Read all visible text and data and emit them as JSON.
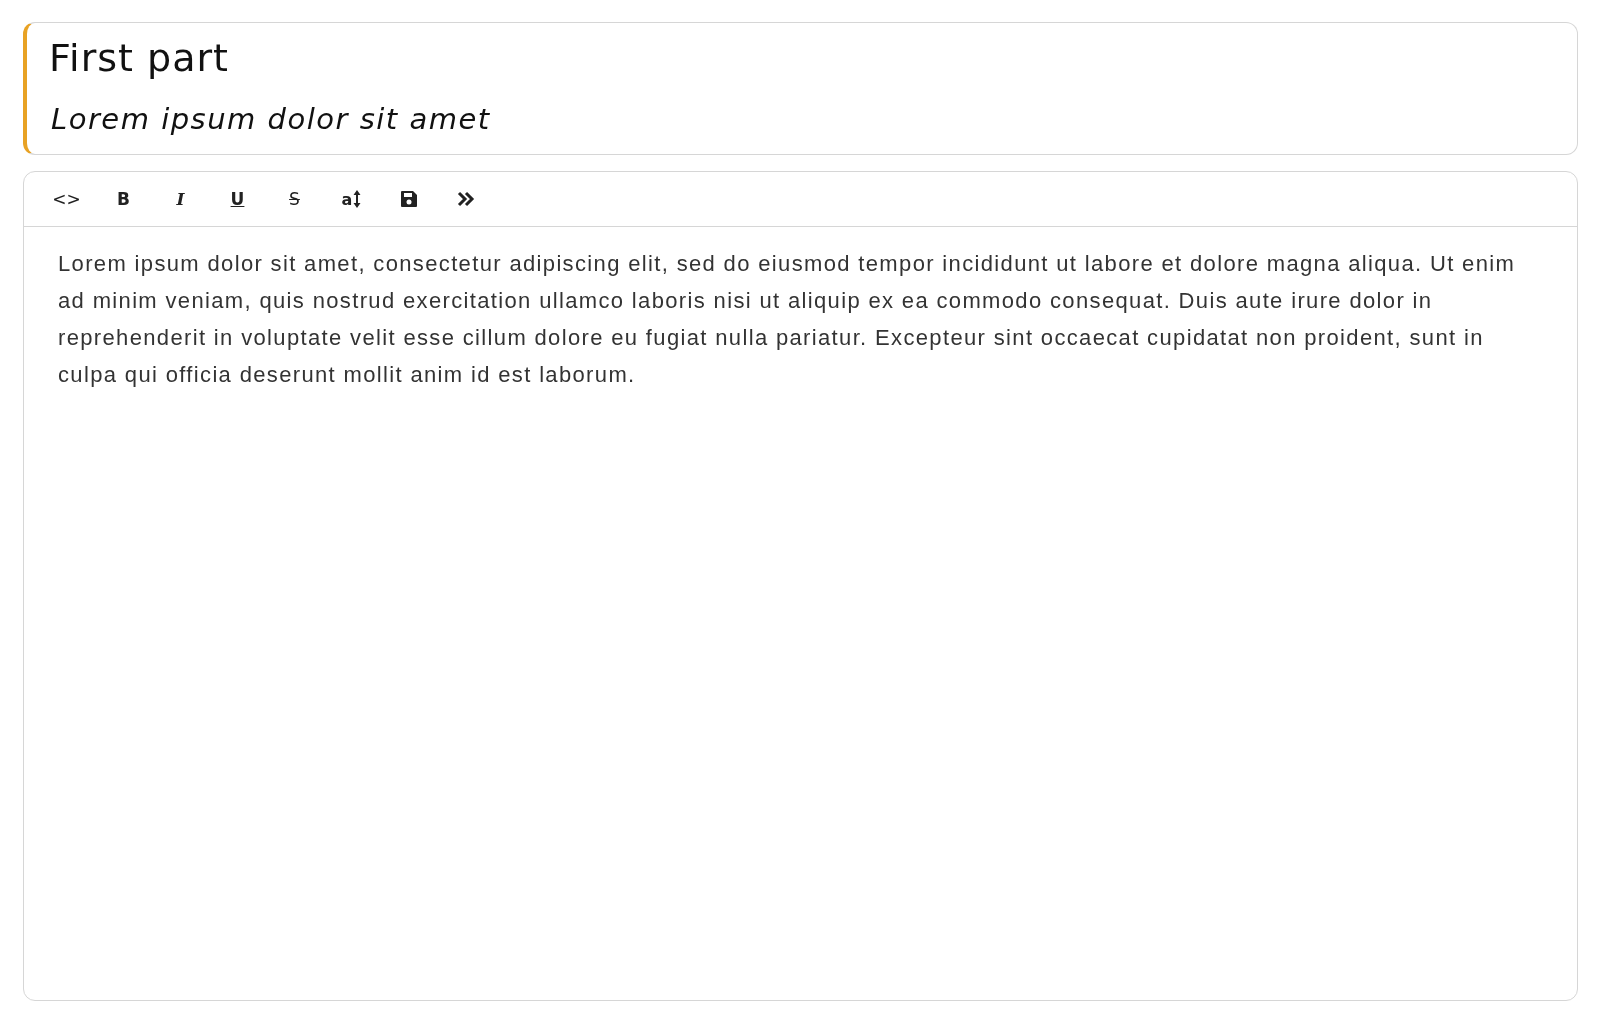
{
  "header": {
    "title": "First part",
    "subtitle": "Lorem ipsum dolor sit amet"
  },
  "toolbar": [
    {
      "kind": "code",
      "label": "<>"
    },
    {
      "kind": "bold",
      "label": "B"
    },
    {
      "kind": "italic",
      "label": "I"
    },
    {
      "kind": "underline",
      "label": "U"
    },
    {
      "kind": "strike",
      "label": "S"
    },
    {
      "kind": "font-size",
      "label": "a"
    },
    {
      "kind": "save"
    },
    {
      "kind": "more"
    }
  ],
  "editor": {
    "text": "Lorem ipsum dolor sit amet, consectetur adipiscing elit, sed do eiusmod tempor incididunt ut labore et dolore magna aliqua. Ut enim ad minim veniam, quis nostrud exercitation ullamco laboris nisi ut aliquip ex ea commodo consequat. Duis aute irure dolor in reprehenderit in voluptate velit esse cillum dolore eu fugiat nulla pariatur. Excepteur sint occaecat cupidatat non proident, sunt in culpa qui officia deserunt mollit anim  id est laborum."
  }
}
